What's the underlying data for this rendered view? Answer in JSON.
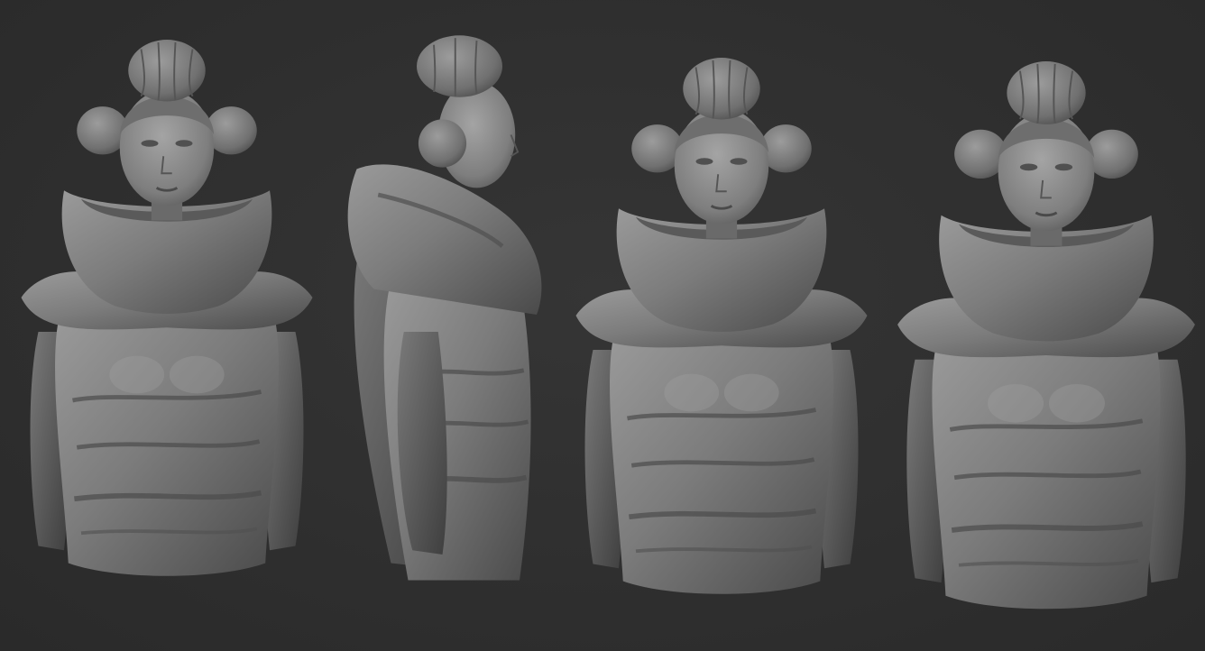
{
  "scene": {
    "background_color": "#303030",
    "material_color": "#7a7a7a",
    "views": [
      {
        "view": "front"
      },
      {
        "view": "side-right"
      },
      {
        "view": "three-quarter-left"
      },
      {
        "view": "three-quarter-right"
      }
    ]
  }
}
